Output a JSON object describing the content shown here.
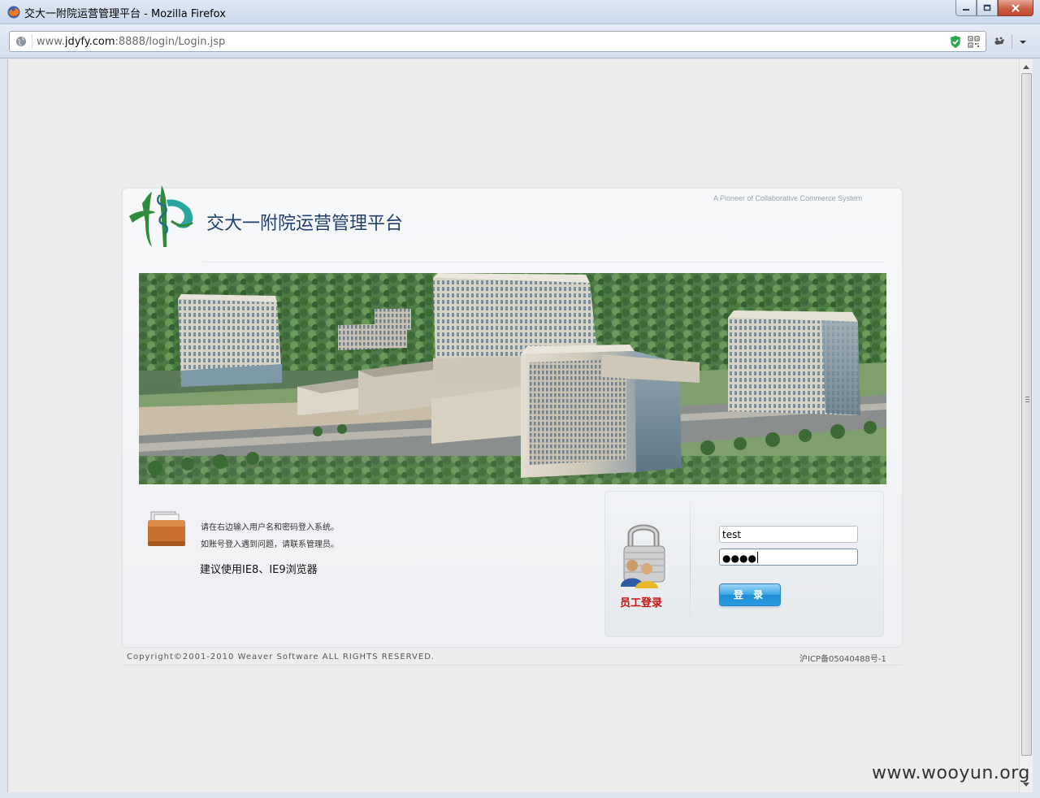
{
  "window": {
    "title": "交大一附院运营管理平台 - Mozilla Firefox",
    "app_icon": "firefox-icon",
    "controls": [
      "minimize-icon",
      "maximize-icon",
      "close-icon"
    ]
  },
  "navbar": {
    "url_prefix": "www.",
    "url_domain": "jdyfy.com",
    "url_rest": ":8888/login/Login.jsp",
    "icons": [
      "globe-icon",
      "shield-icon",
      "qr-code-icon",
      "extension-icon",
      "menu-arrow-icon"
    ]
  },
  "page": {
    "slogan": "A Pioneer of Collaborative Commerce System",
    "brand_title": "交大一附院运营管理平台",
    "banner": "hospital-campus-rendering",
    "colors": {
      "brand_blue": "#1f3f6e",
      "staff_red": "#c41212",
      "button_blue": "#2a9be0",
      "logo_green": "#2f8a3c",
      "logo_teal": "#2aa6a0"
    },
    "tips": {
      "line1": "请在右边输入用户名和密码登入系统。",
      "line2": "如账号登入遇到问题，请联系管理员。",
      "browser_hint": "建议使用IE8、IE9浏览器"
    },
    "login": {
      "label": "员工登录",
      "username_value": "test",
      "password_mask": "●●●●",
      "submit_label": "登 录"
    },
    "footer": {
      "copyright": "Copyright©2001-2010 Weaver Software ALL RIGHTS RESERVED.",
      "icp": "沪ICP备05040488号-1"
    }
  },
  "watermark": "www.wooyun.org"
}
